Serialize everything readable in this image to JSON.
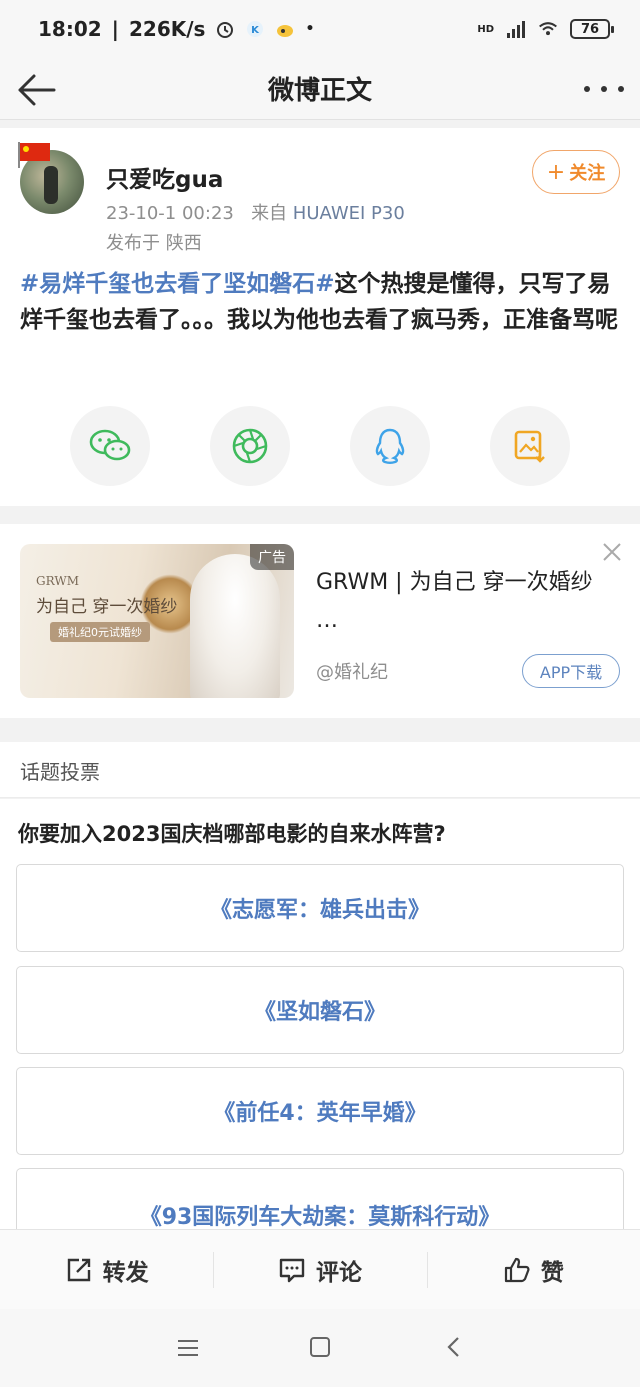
{
  "status_bar": {
    "time": "18:02",
    "net_speed": "226K/s",
    "battery": "76",
    "signal_label": "HD"
  },
  "nav": {
    "title": "微博正文"
  },
  "post": {
    "username": "只爱吃gua",
    "timestamp": "23-10-1 00:23",
    "source_prefix": "来自",
    "device": "HUAWEI P30",
    "location": "发布于 陕西",
    "follow_label": "关注",
    "topic": "#易烊千玺也去看了坚如磐石#",
    "text": "这个热搜是懂得，只写了易烊千玺也去看了。。。我以为他也去看了疯马秀，正准备骂呢",
    "share_targets": [
      "wechat-icon",
      "moments-icon",
      "qq-icon",
      "save-image-icon"
    ]
  },
  "ad": {
    "tag": "广告",
    "title": "GRWM | 为自己 穿一次婚纱 …",
    "source": "@婚礼纪",
    "button": "APP下载",
    "image_text_1": "GRWM",
    "image_text_2": "为自己 穿一次婚纱",
    "image_text_3": "婚礼纪0元试婚纱"
  },
  "vote": {
    "section_title": "话题投票",
    "question": "你要加入2023国庆档哪部电影的自来水阵营?",
    "options": [
      "《志愿军：雄兵出击》",
      "《坚如磐石》",
      "《前任4：英年早婚》",
      "《93国际列车大劫案：莫斯科行动》"
    ]
  },
  "actions": {
    "repost": "转发",
    "comment": "评论",
    "like": "赞"
  },
  "colors": {
    "topic_blue": "#4f7bbf",
    "follow_orange": "#f08a2c",
    "muted_gray": "#8e8e8e"
  }
}
